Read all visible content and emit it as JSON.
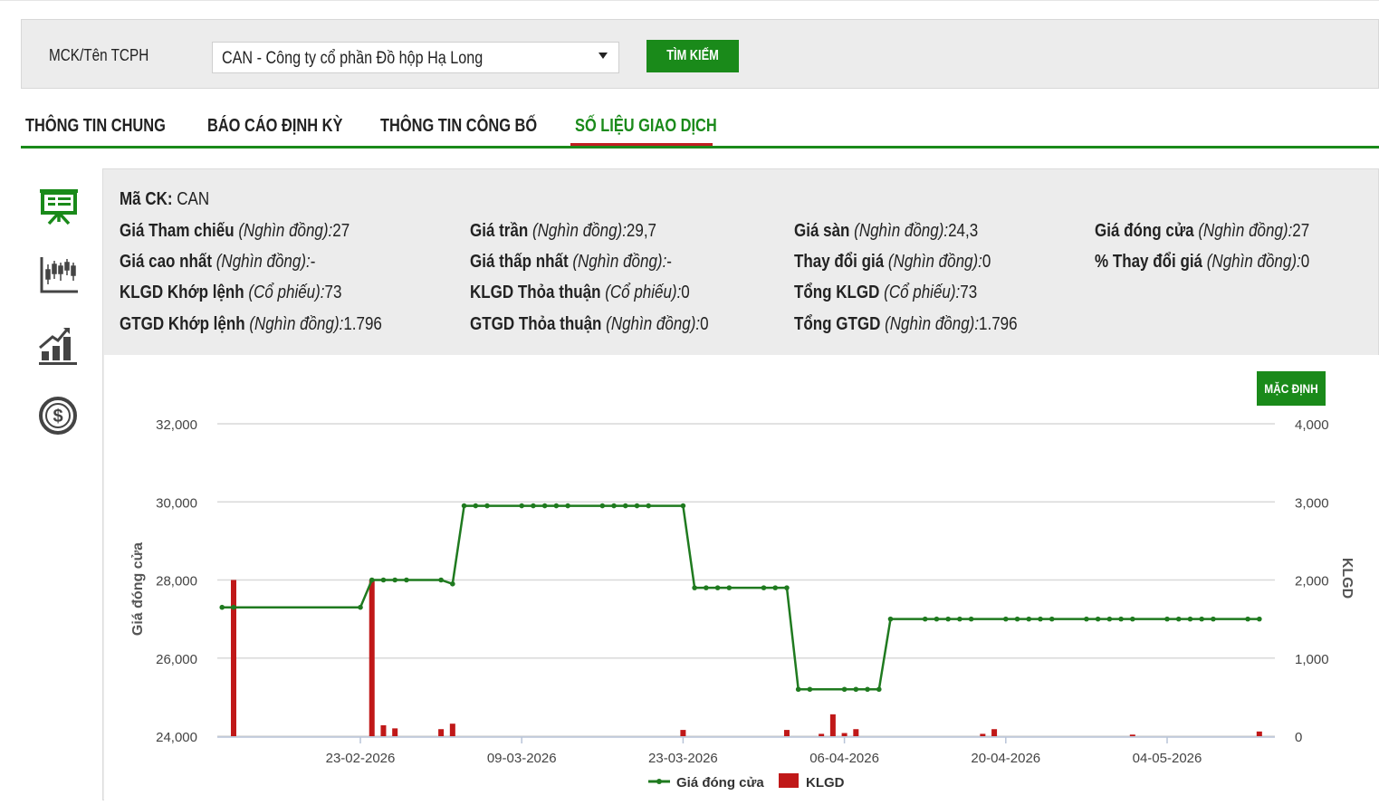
{
  "search": {
    "label": "MCK/Tên TCPH",
    "selected": "CAN - Công ty cổ phần Đồ hộp Hạ Long",
    "button": "TÌM KIẾM"
  },
  "tabs": [
    {
      "label": "THÔNG TIN CHUNG",
      "active": false
    },
    {
      "label": "BÁO CÁO ĐỊNH KỲ",
      "active": false
    },
    {
      "label": "THÔNG TIN CÔNG BỐ",
      "active": false
    },
    {
      "label": "SỐ LIỆU GIAO DỊCH",
      "active": true
    }
  ],
  "side_icons": [
    "presentation-board-icon",
    "candlestick-chart-icon",
    "bar-growth-chart-icon",
    "dollar-coin-icon"
  ],
  "info": {
    "ticker": {
      "label": "Mã CK:",
      "value": "CAN"
    },
    "rows": [
      [
        {
          "label": "Giá Tham chiếu",
          "unit": "(Nghìn đồng):",
          "value": "27"
        },
        {
          "label": "Giá trần",
          "unit": "(Nghìn đồng):",
          "value": "29,7"
        },
        {
          "label": "Giá sàn",
          "unit": "(Nghìn đồng):",
          "value": "24,3"
        },
        {
          "label": "Giá đóng cửa",
          "unit": "(Nghìn đồng):",
          "value": "27"
        }
      ],
      [
        {
          "label": "Giá cao nhất",
          "unit": "(Nghìn đồng):",
          "value": "-"
        },
        {
          "label": "Giá thấp nhất",
          "unit": "(Nghìn đồng):",
          "value": "-"
        },
        {
          "label": "Thay đổi giá",
          "unit": "(Nghìn đồng):",
          "value": "0"
        },
        {
          "label": "% Thay đổi giá",
          "unit": "(Nghìn đồng):",
          "value": "0"
        }
      ],
      [
        {
          "label": "KLGD Khớp lệnh",
          "unit": "(Cổ phiếu):",
          "value": "73"
        },
        {
          "label": "KLGD Thỏa thuận",
          "unit": "(Cổ phiếu):",
          "value": "0"
        },
        {
          "label": "Tổng KLGD",
          "unit": "(Cổ phiếu):",
          "value": "73"
        }
      ],
      [
        {
          "label": "GTGD Khớp lệnh",
          "unit": "(Nghìn đồng):",
          "value": "1.796"
        },
        {
          "label": "GTGD Thỏa thuận",
          "unit": "(Nghìn đồng):",
          "value": "0"
        },
        {
          "label": "Tổng GTGD",
          "unit": "(Nghìn đồng):",
          "value": "1.796"
        }
      ]
    ]
  },
  "chart_button": "MẶC ĐỊNH",
  "chart_data": {
    "type": "line",
    "title": "",
    "ylabel": "Giá đóng cửa",
    "y2label": "KLGD",
    "ylim": [
      24000,
      32000
    ],
    "y2lim": [
      0,
      4000
    ],
    "yticks": [
      "24,000",
      "26,000",
      "28,000",
      "30,000",
      "32,000"
    ],
    "y2ticks": [
      "0",
      "1,000",
      "2,000",
      "3,000",
      "4,000"
    ],
    "xticks": [
      "23-02-2026",
      "09-03-2026",
      "23-03-2026",
      "06-04-2026",
      "20-04-2026",
      "04-05-2026"
    ],
    "xtick_dates": [
      "2026-02-23",
      "2026-03-09",
      "2026-03-23",
      "2026-04-06",
      "2026-04-20",
      "2026-05-04"
    ],
    "grid": true,
    "legend_position": "bottom",
    "colors": {
      "price": "#1f7a1f",
      "volume": "#c01818",
      "grid": "#d9d9d9"
    },
    "series": [
      {
        "name": "Giá đóng cửa",
        "kind": "line",
        "x": [
          "2026-02-11",
          "2026-02-12",
          "2026-02-23",
          "2026-02-24",
          "2026-02-25",
          "2026-02-26",
          "2026-02-27",
          "2026-03-02",
          "2026-03-03",
          "2026-03-04",
          "2026-03-05",
          "2026-03-06",
          "2026-03-09",
          "2026-03-10",
          "2026-03-11",
          "2026-03-12",
          "2026-03-13",
          "2026-03-16",
          "2026-03-17",
          "2026-03-18",
          "2026-03-19",
          "2026-03-20",
          "2026-03-23",
          "2026-03-24",
          "2026-03-25",
          "2026-03-26",
          "2026-03-27",
          "2026-03-30",
          "2026-03-31",
          "2026-04-01",
          "2026-04-02",
          "2026-04-03",
          "2026-04-06",
          "2026-04-07",
          "2026-04-08",
          "2026-04-09",
          "2026-04-10",
          "2026-04-13",
          "2026-04-14",
          "2026-04-15",
          "2026-04-16",
          "2026-04-17",
          "2026-04-20",
          "2026-04-21",
          "2026-04-22",
          "2026-04-23",
          "2026-04-24",
          "2026-04-27",
          "2026-04-28",
          "2026-04-29",
          "2026-04-30",
          "2026-05-01",
          "2026-05-04",
          "2026-05-05",
          "2026-05-06",
          "2026-05-07",
          "2026-05-08",
          "2026-05-11",
          "2026-05-12"
        ],
        "values": [
          27300,
          27300,
          27300,
          28000,
          28000,
          28000,
          28000,
          28000,
          27900,
          29900,
          29900,
          29900,
          29900,
          29900,
          29900,
          29900,
          29900,
          29900,
          29900,
          29900,
          29900,
          29900,
          29900,
          27800,
          27800,
          27800,
          27800,
          27800,
          27800,
          27800,
          25200,
          25200,
          25200,
          25200,
          25200,
          25200,
          27000,
          27000,
          27000,
          27000,
          27000,
          27000,
          27000,
          27000,
          27000,
          27000,
          27000,
          27000,
          27000,
          27000,
          27000,
          27000,
          27000,
          27000,
          27000,
          27000,
          27000,
          27000,
          27000
        ]
      },
      {
        "name": "KLGD",
        "kind": "bar",
        "x": [
          "2026-02-12",
          "2026-02-24",
          "2026-02-25",
          "2026-02-26",
          "2026-03-02",
          "2026-03-03",
          "2026-03-23",
          "2026-04-01",
          "2026-04-04",
          "2026-04-05",
          "2026-04-06",
          "2026-04-07",
          "2026-04-18",
          "2026-04-19",
          "2026-05-01",
          "2026-05-12"
        ],
        "values": [
          2000,
          2000,
          140,
          100,
          90,
          160,
          80,
          80,
          30,
          280,
          40,
          90,
          30,
          90,
          20,
          60
        ]
      }
    ]
  }
}
